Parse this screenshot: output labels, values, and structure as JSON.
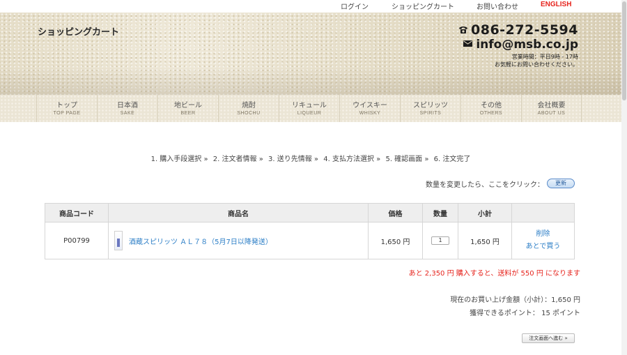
{
  "topbar": {
    "login": "ログイン",
    "cart": "ショッピングカート",
    "contact": "お問い合わせ",
    "english": "ENGLISH"
  },
  "header": {
    "title": "ショッピングカート",
    "phone": "086-272-5594",
    "email": "info@msb.co.jp",
    "hours_line1": "営業時間：平日9時 - 17時",
    "hours_line2": "お気軽にお問い合わせください。"
  },
  "nav": [
    {
      "jp": "トップ",
      "en": "TOP PAGE"
    },
    {
      "jp": "日本酒",
      "en": "SAKE"
    },
    {
      "jp": "地ビール",
      "en": "BEER"
    },
    {
      "jp": "焼酎",
      "en": "SHOCHU"
    },
    {
      "jp": "リキュール",
      "en": "LIQUEUR"
    },
    {
      "jp": "ウイスキー",
      "en": "WHISKY"
    },
    {
      "jp": "スピリッツ",
      "en": "SPIRITS"
    },
    {
      "jp": "その他",
      "en": "OTHERS"
    },
    {
      "jp": "会社概要",
      "en": "ABOUT US"
    }
  ],
  "steps": [
    "1. 購入手段選択 »",
    "2. 注文者情報 »",
    "3. 送り先情報 »",
    "4. 支払方法選択 »",
    "5. 確認画面 »",
    "6. 注文完了"
  ],
  "qty_note": "数量を変更したら、ここをクリック：",
  "update_button": "更新",
  "table": {
    "headers": [
      "商品コード",
      "商品名",
      "価格",
      "数量",
      "小計",
      ""
    ],
    "rows": [
      {
        "code": "P00799",
        "name": "酒蔵スピリッツ ＡＬ７８（5月7日以降発送）",
        "price": "1,650 円",
        "qty": "1",
        "subtotal": "1,650 円",
        "delete": "削除",
        "later": "あとで買う"
      }
    ]
  },
  "shipping_note": "あと 2,350 円 購入すると、送料が 550 円 になります",
  "total_line": "現在のお買い上げ金額（小計）：1,650 円",
  "points_line": "獲得できるポイント： 15 ポイント",
  "next_button": "注文画面へ進む »",
  "colors": {
    "accent_red": "#e6231c",
    "link_blue": "#2a7dc6"
  }
}
